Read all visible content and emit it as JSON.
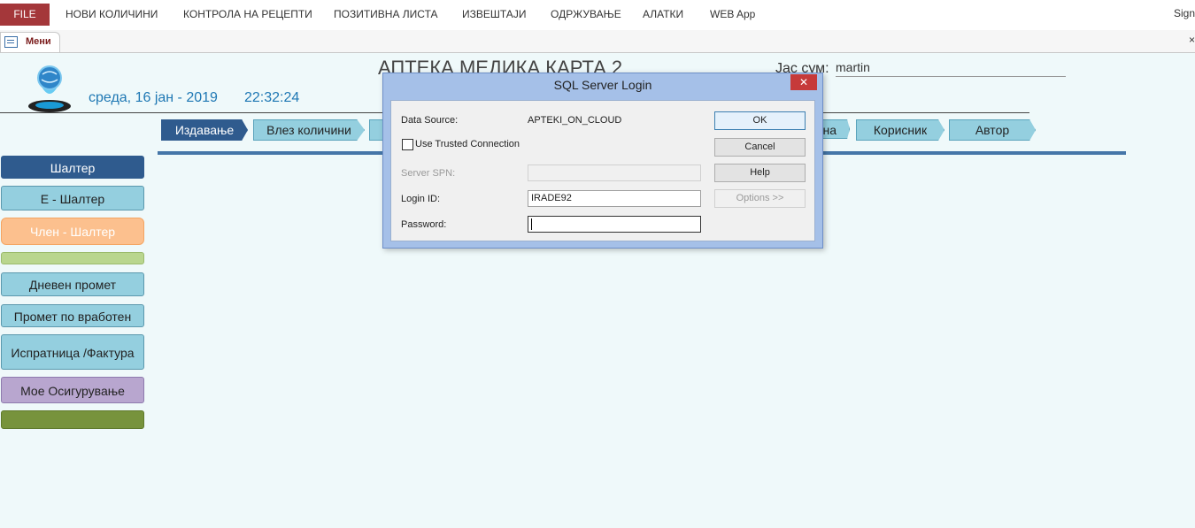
{
  "ribbon": {
    "file": "FILE",
    "items": [
      "НОВИ КОЛИЧИНИ",
      "КОНТРОЛА НА РЕЦЕПТИ",
      "ПОЗИТИВНА ЛИСТА",
      "ИЗВЕШТАЈИ",
      "ОДРЖУВАЊЕ",
      "АЛАТКИ",
      "WEB App"
    ],
    "sign_in": "Sign"
  },
  "doc_tab": {
    "label": "Мени",
    "close": "×"
  },
  "header": {
    "title": "АПТЕКА  МЕДИКА КАРТА 2",
    "date": "среда, 16 јан - 2019",
    "time": "22:32:24",
    "user_label": "Јас сум:",
    "user_value": "martin"
  },
  "nav_tabs": [
    "Издавање",
    "Влез количини",
    "",
    "на",
    "Корисник",
    "Автор"
  ],
  "sidebar": [
    "Шалтер",
    "Е - Шалтер",
    "Член - Шалтер",
    "",
    "Дневен промет",
    "Промет по вработен",
    "Испратница /Фактура",
    "Мое Осигурување",
    ""
  ],
  "dialog": {
    "title": "SQL Server Login",
    "close": "✕",
    "data_source_label": "Data Source:",
    "data_source_value": "APTEKI_ON_CLOUD",
    "trusted_label": "Use Trusted Connection",
    "server_spn_label": "Server SPN:",
    "server_spn_value": "",
    "login_id_label": "Login ID:",
    "login_id_value": "IRADE92",
    "password_label": "Password:",
    "password_value": "",
    "ok": "OK",
    "cancel": "Cancel",
    "help": "Help",
    "options": "Options >>"
  }
}
